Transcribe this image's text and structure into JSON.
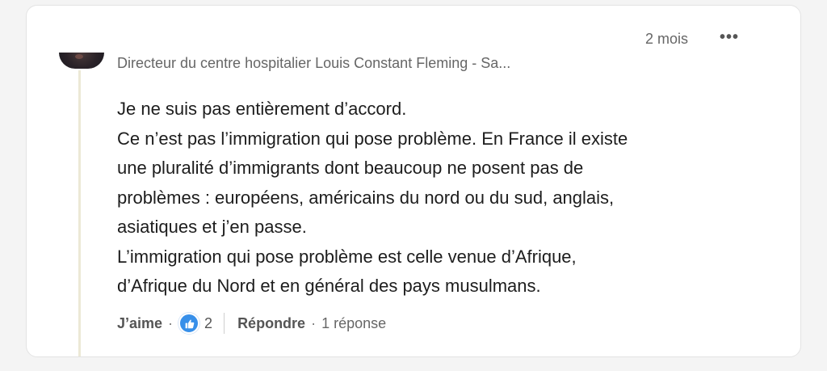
{
  "comment": {
    "timestamp": "2 mois",
    "more_label": "•••",
    "author_headline": "Directeur du centre hospitalier Louis Constant Fleming - Sa...",
    "body": [
      "Je ne suis pas entièrement d’accord.",
      "Ce n’est pas l’immigration qui pose problème. En France il existe",
      "une pluralité d’immigrants dont beaucoup ne posent pas de",
      "problèmes : européens, américains du nord ou du sud, anglais,",
      "asiatiques et j’en passe.",
      "L’immigration qui pose problème est celle venue d’Afrique,",
      "d’Afrique du Nord et en général des pays musulmans."
    ],
    "actions": {
      "like_label": "J’aime",
      "separator": "·",
      "reaction_icon": "thumbs-up-icon",
      "reaction_count": "2",
      "reply_label": "Répondre",
      "reply_count": "1 réponse"
    }
  },
  "colors": {
    "reaction_blue": "#378fe9",
    "text_primary": "#1d1d1d",
    "text_secondary": "#666666"
  }
}
